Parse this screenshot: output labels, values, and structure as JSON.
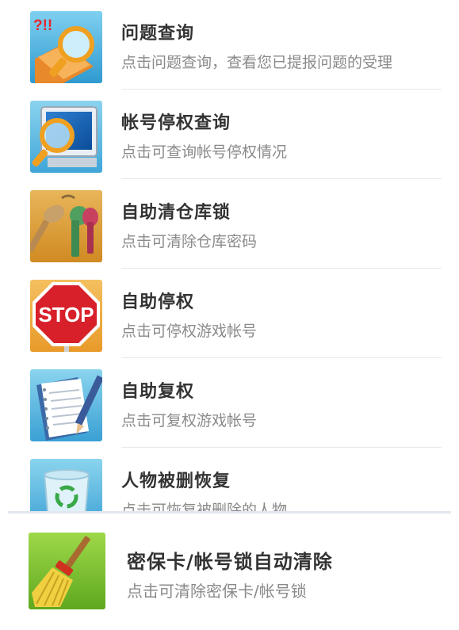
{
  "services": [
    {
      "title": "问题查询",
      "desc": "点击问题查询，查看您已提报问题的受理",
      "icon": "magnifier-book-icon",
      "icon_text": "?!!"
    },
    {
      "title": "帐号停权查询",
      "desc": "点击可查询帐号停权情况",
      "icon": "computer-magnifier-icon"
    },
    {
      "title": "自助清仓库锁",
      "desc": "点击可清除仓库密码",
      "icon": "keys-icon"
    },
    {
      "title": "自助停权",
      "desc": "点击可停权游戏帐号",
      "icon": "stop-sign-icon",
      "icon_text": "STOP"
    },
    {
      "title": "自助复权",
      "desc": "点击可复权游戏帐号",
      "icon": "notepad-pencil-icon"
    },
    {
      "title": "人物被删恢复",
      "desc": "点击可恢复被删除的人物",
      "icon": "recycle-bin-icon"
    }
  ],
  "pinned": {
    "title": "密保卡/帐号锁自动清除",
    "desc": "点击可清除密保卡/帐号锁",
    "icon": "broom-icon"
  },
  "colors": {
    "title": "#333333",
    "desc": "#8a8a8a",
    "separator": "#e8e8e8"
  }
}
